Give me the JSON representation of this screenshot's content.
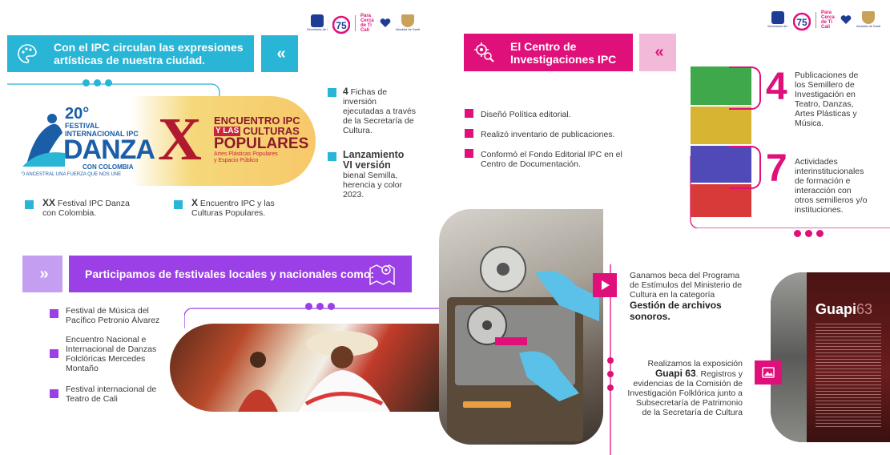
{
  "logos": {
    "left": [
      "Secretaría de Cultura",
      "Cali 75",
      "Para Cerca de Ti Cali",
      "Alcaldía de Santiago de Cali"
    ],
    "right": [
      "Secretaría de Cultura",
      "Cali 75",
      "Para Cerca de Ti Cali",
      "Alcaldía de Santiago de Cali"
    ]
  },
  "sec1": {
    "title_line1": "Con el IPC circulan las expresiones",
    "title_line2": "artísticas de nuestra ciudad.",
    "chevrons": "«",
    "festival_num": "20°",
    "festival_name1": "FESTIVAL",
    "festival_name2": "INTERNACIONAL IPC",
    "festival_danza": "DANZA",
    "festival_con": "CON COLOMBIA",
    "festival_slogan": "LO ANCESTRAL UNA FUERZA QUE NOS UNE",
    "encuentro_x": "X",
    "encuentro_1": "ENCUENTRO IPC",
    "encuentro_2": "Y LAS",
    "encuentro_3": "CULTURAS",
    "encuentro_4": "POPULARES",
    "encuentro_5": "Artes Plásticas Populares",
    "encuentro_6": "y Espacio Público",
    "item1_bold": "XX",
    "item1_text": " Festival IPC Danza",
    "item1_text2": "con Colombia.",
    "item2_bold": "X",
    "item2_text": " Encuentro IPC y las",
    "item2_text2": "Culturas Populares.",
    "fichas_bold": "4",
    "fichas_l1": " Fichas de",
    "fichas_l2": "inversión",
    "fichas_l3": "ejecutadas a través",
    "fichas_l4": "de la Secretaría de",
    "fichas_l5": "Cultura.",
    "lanz_l1": "Lanzamiento",
    "lanz_l2": "VI versión",
    "lanz_l3": "bienal Semilla,",
    "lanz_l4": "herencia y color",
    "lanz_l5": "2023."
  },
  "sec2": {
    "title_line1": "El Centro de",
    "title_line2": "Investigaciones IPC",
    "chevrons": "«",
    "items": [
      "Diseñó Política editorial.",
      "Realizó inventario de publicaciones.",
      "Conformó el Fondo Editorial IPC en el",
      "Centro de Documentación."
    ],
    "stat1_num": "4",
    "stat1_l1": "Publicaciones de",
    "stat1_l2": "los Semillero de",
    "stat1_l3": "Investigación en",
    "stat1_l4": "Teatro, Danzas,",
    "stat1_l5": "Artes Plásticas y",
    "stat1_l6": "Música.",
    "stat2_num": "7",
    "stat2_l1": "Actividades",
    "stat2_l2": "interinstitucionales",
    "stat2_l3": "de formación e",
    "stat2_l4": "interacción con",
    "stat2_l5": "otros semilleros y/o",
    "stat2_l6": "instituciones."
  },
  "sec3": {
    "chevrons": "»",
    "title": "Participamos de festivales locales y nacionales como:",
    "f1_l1": "Festival de Música del",
    "f1_l2": "Pacífico Petronio Álvarez",
    "f2_l1": "Encuentro Nacional e",
    "f2_l2": "Internacional de Danzas",
    "f2_l3": "Folclóricas Mercedes",
    "f2_l4": "Montaño",
    "f3_l1": "Festival internacional de",
    "f3_l2": "Teatro de Cali"
  },
  "sec4": {
    "beca_l1": "Ganamos beca del Programa",
    "beca_l2": "de Estímulos del Ministerio de",
    "beca_l3": "Cultura en la categoría",
    "beca_b1": "Gestión de archivos",
    "beca_b2": "sonoros.",
    "expo_l1": "Realizamos la exposición",
    "expo_b": "Guapi 63",
    "expo_l2": ". Registros y",
    "expo_l3": "evidencias de la Comisión de",
    "expo_l4": "Investigación Folklórica junto a",
    "expo_l5": "Subsecretaría de Patrimonio",
    "expo_l6": "de la Secretaría de Cultura",
    "guapi_title": "Guapi",
    "guapi_num": "63"
  },
  "colors": {
    "cyan": "#29b5d5",
    "magenta": "#e0107b",
    "purple": "#9b3fe6"
  }
}
